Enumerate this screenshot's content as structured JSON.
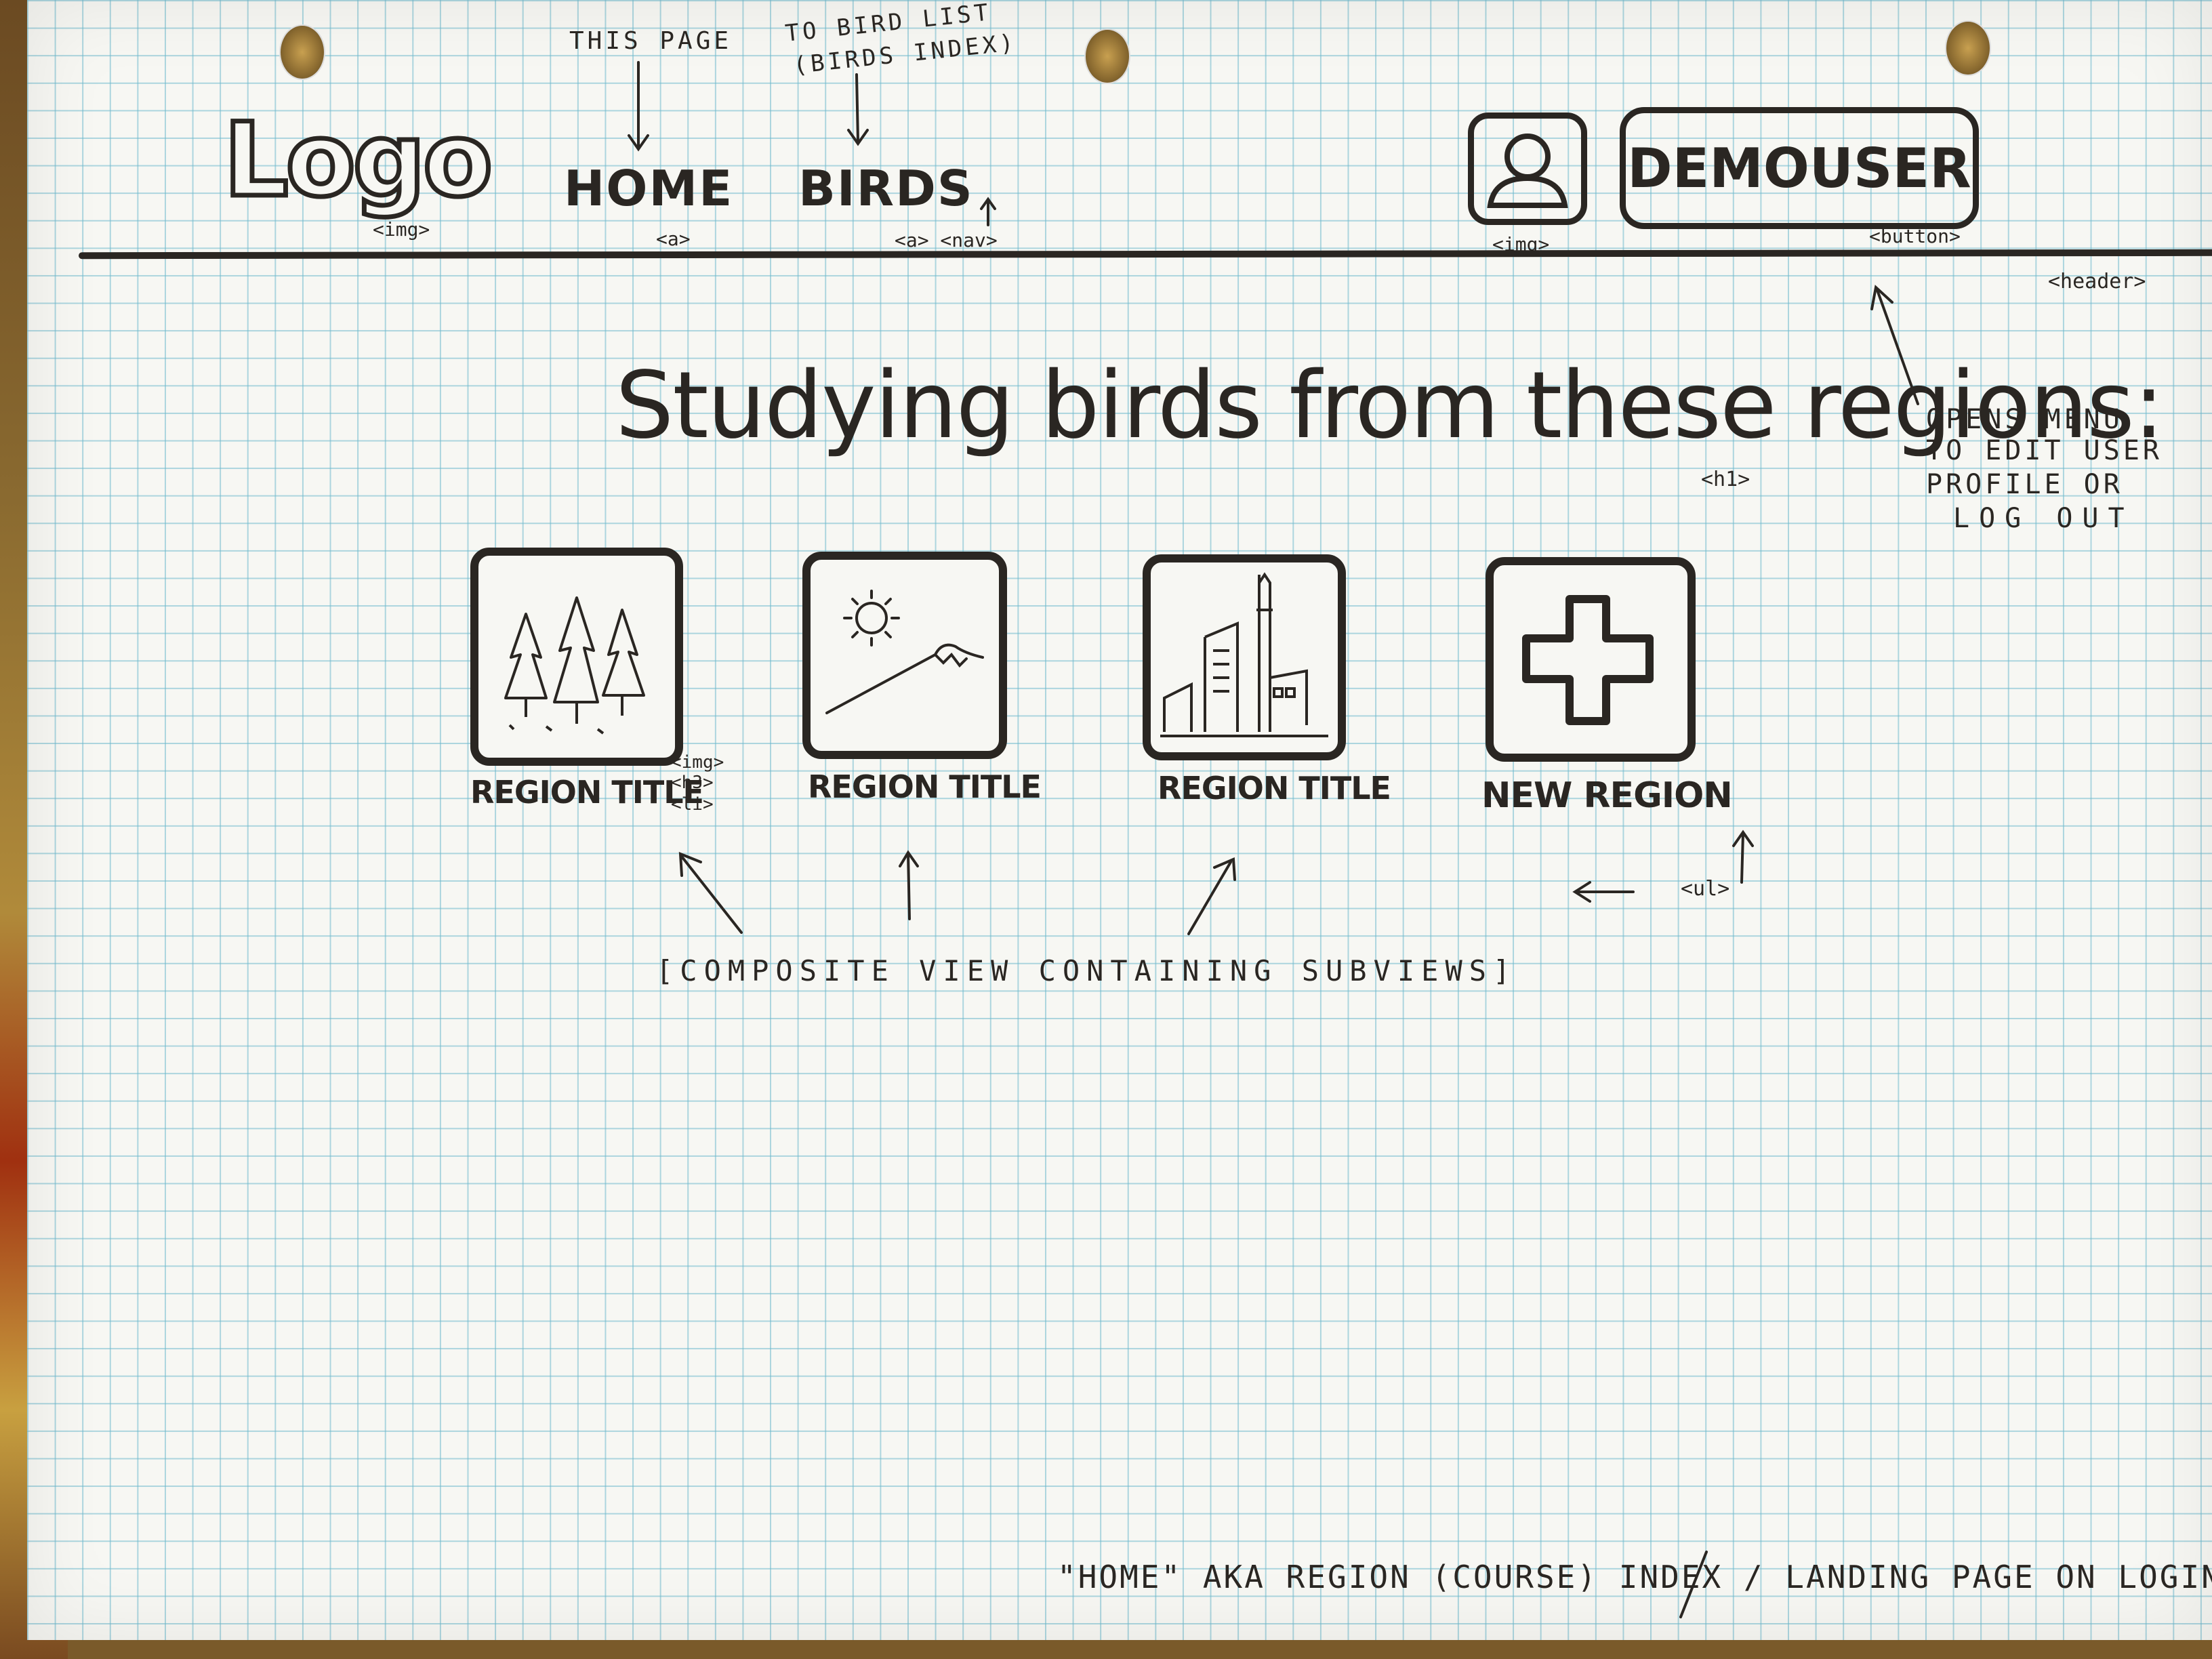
{
  "annotations": {
    "this_page": "THIS PAGE",
    "to_bird_list_line1": "TO BIRD LIST",
    "to_bird_list_line2": "(BIRDS INDEX)",
    "tag_img_logo": "<img>",
    "tag_a_home": "<a>",
    "tag_a_nav": "<a> <nav>",
    "tag_img_avatar": "<img>",
    "tag_button": "<button>",
    "tag_header": "<header>",
    "opens_menu": [
      "OPENS MENU",
      "TO EDIT USER",
      "PROFILE OR",
      "LOG OUT"
    ],
    "tag_h1": "<h1>",
    "tag_img_region": "<img>",
    "tag_h3": "<h3>",
    "tag_li": "<li>",
    "tag_ul": "<ul>",
    "composite_view": "[COMPOSITE VIEW CONTAINING SUBVIEWS]",
    "footer_caption": "\"HOME\" AKA REGION (COURSE) INDEX / LANDING PAGE ON LOGIN"
  },
  "header": {
    "logo": "Logo",
    "nav": {
      "home": "HOME",
      "birds": "BIRDS"
    },
    "user_button": "DEMOUSER",
    "avatar_icon": "user-avatar-icon"
  },
  "main": {
    "heading": "Studying birds from these regions:",
    "regions": [
      {
        "title": "REGION TITLE",
        "icon": "forest-icon"
      },
      {
        "title": "REGION TITLE",
        "icon": "mountain-sun-icon"
      },
      {
        "title": "REGION TITLE",
        "icon": "city-icon"
      }
    ],
    "new_region": {
      "title": "NEW REGION",
      "icon": "plus-icon"
    }
  },
  "colors": {
    "ink": "#2a2622",
    "grid": "#6eb9cd",
    "paper": "#f7f7f3"
  }
}
